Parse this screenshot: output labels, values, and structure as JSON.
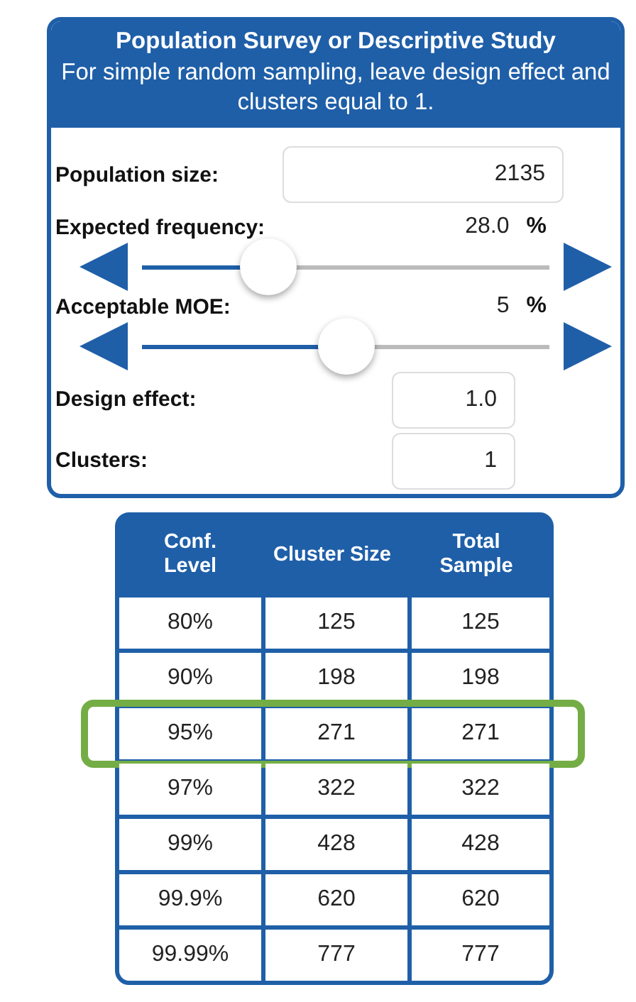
{
  "panel": {
    "title": "Population Survey or Descriptive Study",
    "subtitle": "For simple random sampling, leave design effect and clusters equal to 1.",
    "fields": [
      {
        "kind": "wideinput",
        "label": "Population size:",
        "value": "2135"
      },
      {
        "kind": "slider",
        "label": "Expected frequency:",
        "value": "28.0",
        "unit": "%",
        "level": 0.31
      },
      {
        "kind": "slider",
        "label": "Acceptable MOE:",
        "value": "5",
        "unit": "%",
        "level": 0.5
      },
      {
        "kind": "input",
        "label": "Design effect:",
        "value": "1.0"
      },
      {
        "kind": "input",
        "label": "Clusters:",
        "value": "1"
      }
    ]
  },
  "table": {
    "columns": [
      "Conf. Level",
      "Cluster Size",
      "Total Sample"
    ],
    "rows": [
      {
        "cells": [
          "80%",
          "125",
          "125"
        ],
        "selected": false
      },
      {
        "cells": [
          "90%",
          "198",
          "198"
        ],
        "selected": false
      },
      {
        "cells": [
          "95%",
          "271",
          "271"
        ],
        "selected": true
      },
      {
        "cells": [
          "97%",
          "322",
          "322"
        ],
        "selected": false
      },
      {
        "cells": [
          "99%",
          "428",
          "428"
        ],
        "selected": false
      },
      {
        "cells": [
          "99.9%",
          "620",
          "620"
        ],
        "selected": false
      },
      {
        "cells": [
          "99.99%",
          "777",
          "777"
        ],
        "selected": false
      }
    ]
  }
}
